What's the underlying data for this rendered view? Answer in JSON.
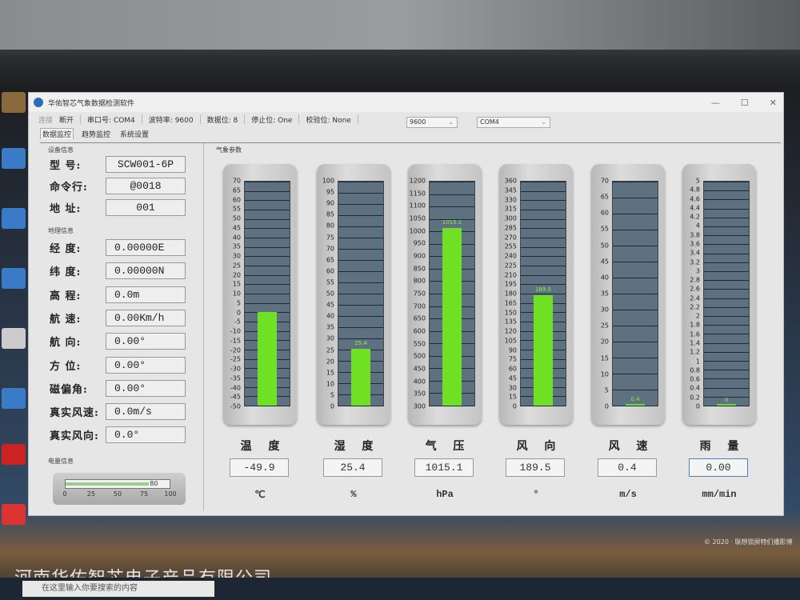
{
  "window": {
    "title": "华佑智芯气象数据检测软件",
    "controls": [
      "—",
      "☐",
      "✕"
    ]
  },
  "toolbar": {
    "connect": "连接",
    "disconnect": "断开",
    "port": "串口号: COM4",
    "baud": "波特率: 9600",
    "databits": "数据位: 8",
    "stopbits": "停止位: One",
    "parity": "校验位: None",
    "baud_select": "9600",
    "port_select": "COM4"
  },
  "tabs": [
    {
      "label": "数据监控",
      "active": true
    },
    {
      "label": "趋势监控"
    },
    {
      "label": "系统设置"
    }
  ],
  "device": {
    "section": "设备信息",
    "rows": [
      {
        "label": "型    号:",
        "value": "SCW001-6P"
      },
      {
        "label": "命令行:",
        "value": "@0018"
      },
      {
        "label": "地    址:",
        "value": "001"
      }
    ]
  },
  "geo": {
    "section": "地理信息",
    "rows": [
      {
        "label": "经    度:",
        "value": "0.00000E"
      },
      {
        "label": "纬    度:",
        "value": "0.00000N"
      },
      {
        "label": "高    程:",
        "value": "0.0m"
      },
      {
        "label": "航    速:",
        "value": "0.00Km/h"
      },
      {
        "label": "航    向:",
        "value": "0.00°"
      },
      {
        "label": "方    位:",
        "value": "0.00°"
      },
      {
        "label": "磁偏角:",
        "value": "0.00°"
      },
      {
        "label": "真实风速:",
        "value": "0.0m/s"
      },
      {
        "label": "真实风向:",
        "value": "0.0°"
      }
    ]
  },
  "battery": {
    "section": "电量信息",
    "value": 80,
    "label": "80",
    "ticks": [
      "0",
      "25",
      "50",
      "75",
      "100"
    ]
  },
  "params_title": "气象参数",
  "gauges": [
    {
      "name": "温 度",
      "value": "-49.9",
      "unit": "℃",
      "min": -50,
      "max": 70,
      "step": 5,
      "level": 0,
      "bar_label": ""
    },
    {
      "name": "湿 度",
      "value": "25.4",
      "unit": "%",
      "min": 0,
      "max": 100,
      "step": 5,
      "level": 25.4,
      "bar_label": "25.4"
    },
    {
      "name": "气 压",
      "value": "1015.1",
      "unit": "hPa",
      "min": 300,
      "max": 1200,
      "step": 50,
      "level": 1015.1,
      "bar_label": "1015.1"
    },
    {
      "name": "风 向",
      "value": "189.5",
      "unit": "°",
      "min": 0,
      "max": 360,
      "step": 15,
      "level": 178,
      "bar_label": "189.5"
    },
    {
      "name": "风 速",
      "value": "0.4",
      "unit": "m/s",
      "min": 0,
      "max": 70,
      "step": 5,
      "level": 0.4,
      "bar_label": "0.4"
    },
    {
      "name": "雨 量",
      "value": "0.00",
      "unit": "mm/min",
      "min": 0,
      "max": 5,
      "step": 0.2,
      "level": 0,
      "bar_label": "0"
    }
  ],
  "colors": {
    "bar": "#6fe024",
    "scale_bg": "#5d7180"
  },
  "taskbar": {
    "search_placeholder": "在这里输入你要搜索的内容"
  },
  "watermark": "河南华佑智芯电子产品有限公司",
  "copyright": "© 2020 · 联想锁屏特们播影博"
}
